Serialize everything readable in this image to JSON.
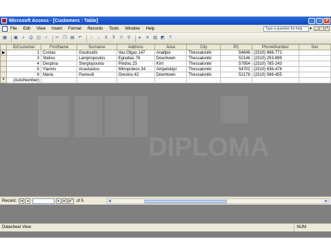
{
  "window": {
    "title": "Microsoft Access - [Customers : Table]"
  },
  "menu": [
    "File",
    "Edit",
    "View",
    "Insert",
    "Format",
    "Records",
    "Tools",
    "Window",
    "Help"
  ],
  "help_box": {
    "placeholder": "Type a question for help"
  },
  "table": {
    "columns": [
      "IDCustomer",
      "FirstName",
      "Surname",
      "Address",
      "Area",
      "City",
      "PC",
      "PhoneNumber",
      "Sex"
    ],
    "rows": [
      [
        "1",
        "Costas",
        "Goutoudis",
        "Vas.Olgas 147",
        "Analipsi",
        "Thessaloniki",
        "54646",
        "(2310) 866-771",
        ""
      ],
      [
        "3",
        "Stelios",
        "Lampropoulos",
        "Egnatias 76",
        "Downtown",
        "Thessaloniki",
        "52146",
        "(2310) 253-895",
        ""
      ],
      [
        "4",
        "Despina",
        "Stergiopoulou",
        "Pindou 23",
        "Kirri",
        "Thessaloniki",
        "57954",
        "(2310) 785-243",
        ""
      ],
      [
        "5",
        "Yiannis",
        "Anastasiou",
        "Mitropoleos 34",
        "Ampelokipi",
        "Thessaloniki",
        "54702",
        "(2310) 636-478",
        ""
      ],
      [
        "6",
        "Maria",
        "Panoudi",
        "Orestou 42",
        "Downtown",
        "Thessaloniki",
        "52178",
        "(2310) 586-455",
        ""
      ]
    ],
    "new_row_placeholder": "(AutoNumber)"
  },
  "navigation": {
    "label": "Record:",
    "current": "1",
    "of_text": "of 5"
  },
  "watermark": {
    "brand": "DIPLOMA"
  },
  "status": {
    "view": "Datasheet View",
    "mode": "NUM"
  }
}
